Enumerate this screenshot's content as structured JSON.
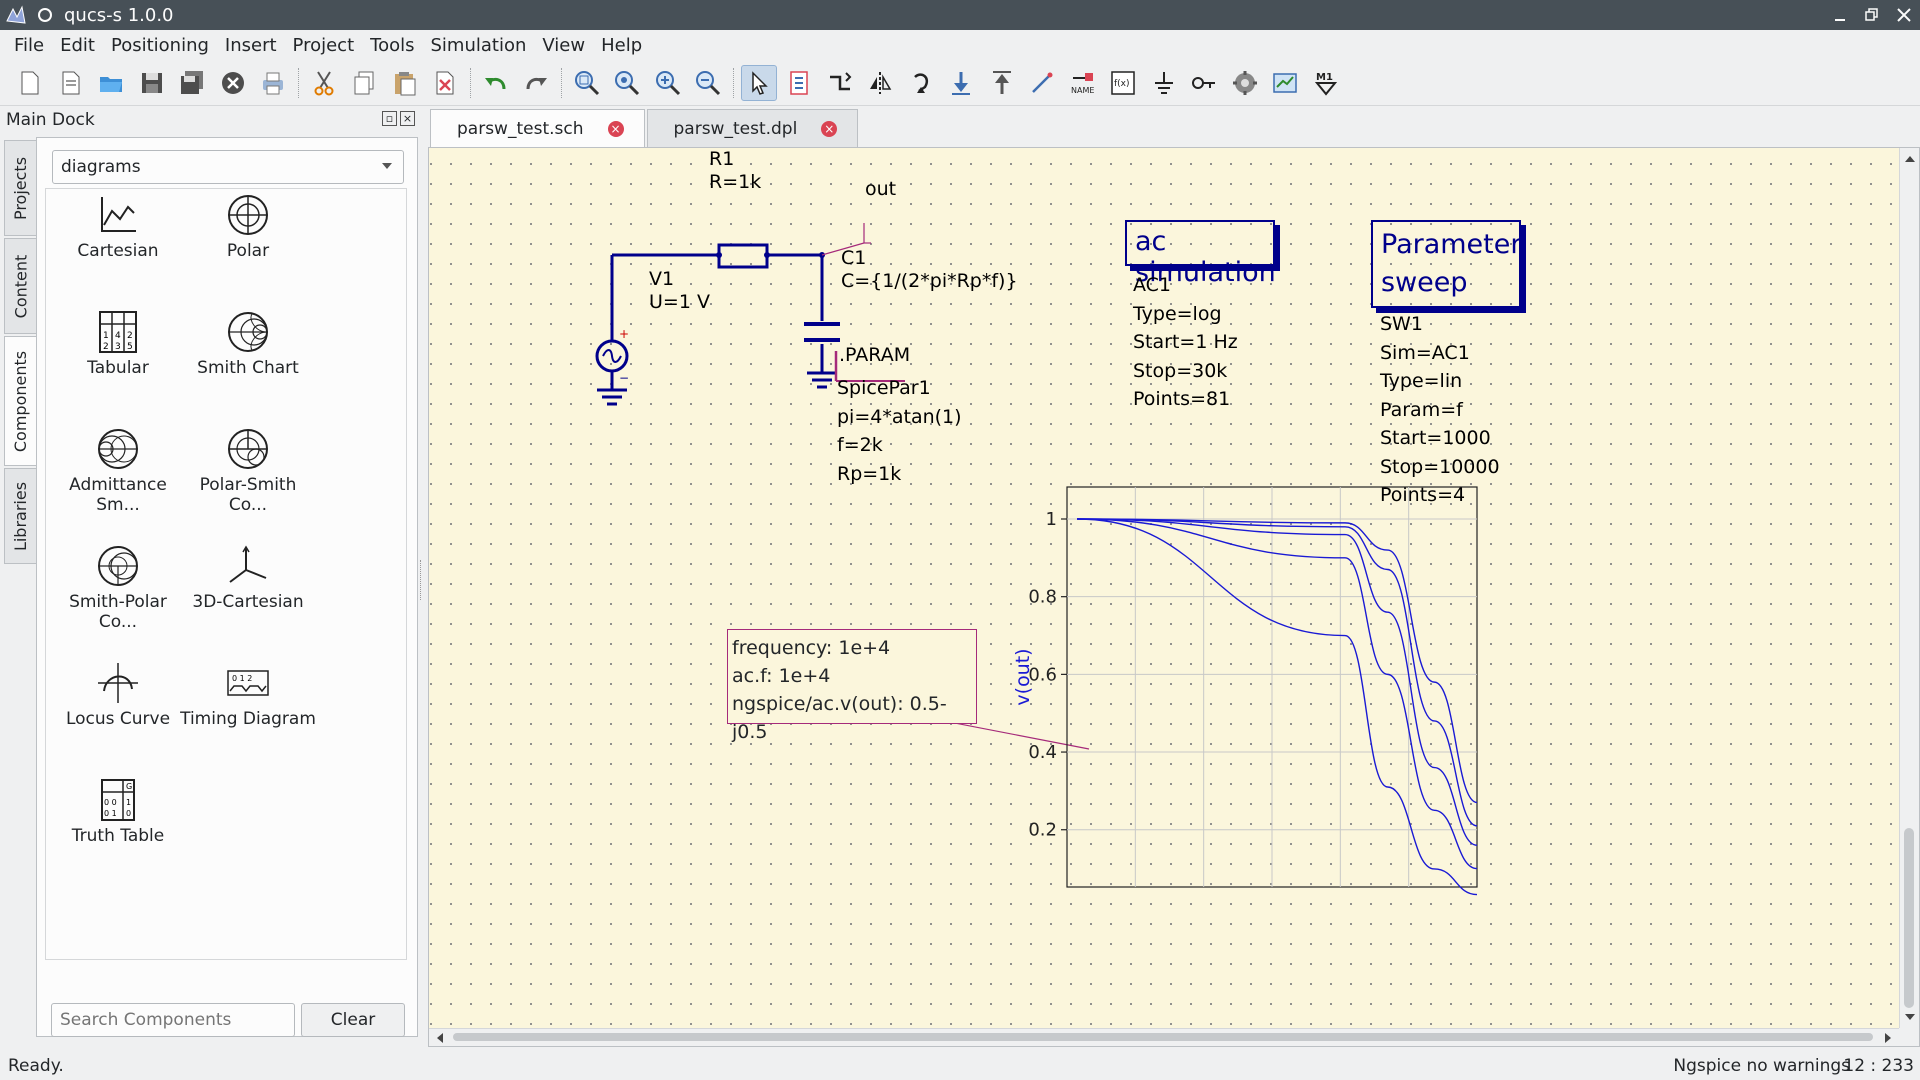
{
  "window": {
    "title": "qucs-s 1.0.0"
  },
  "menu": [
    "File",
    "Edit",
    "Positioning",
    "Insert",
    "Project",
    "Tools",
    "Simulation",
    "View",
    "Help"
  ],
  "toolbar": {
    "icons": [
      "new-file-icon",
      "new-text-icon",
      "open-folder-icon",
      "save-icon",
      "save-all-icon",
      "close-document-icon",
      "print-icon",
      "cut-icon",
      "copy-icon",
      "paste-icon",
      "delete-icon",
      "undo-icon",
      "redo-icon",
      "zoom-fit-icon",
      "zoom-selection-icon",
      "zoom-in-icon",
      "zoom-out-icon",
      "select-pointer-icon",
      "edit-properties-icon",
      "rotate-mirror-icon",
      "mirror-icon",
      "rotate-icon",
      "enter-subcircuit-icon",
      "exit-subcircuit-icon",
      "wire-icon",
      "wire-label-icon",
      "equation-icon",
      "ground-icon",
      "port-icon",
      "simulate-icon",
      "view-results-icon",
      "set-marker-icon"
    ]
  },
  "dock": {
    "title": "Main Dock",
    "tabs": [
      "Projects",
      "Content",
      "Components",
      "Libraries"
    ],
    "active_tab": "Components",
    "category": "diagrams",
    "components": [
      {
        "label": "Cartesian",
        "icon": "cartesian-diagram-icon"
      },
      {
        "label": "Polar",
        "icon": "polar-diagram-icon"
      },
      {
        "label": "Tabular",
        "icon": "tabular-diagram-icon"
      },
      {
        "label": "Smith Chart",
        "icon": "smith-chart-icon"
      },
      {
        "label": "Admittance Sm...",
        "icon": "admittance-smith-icon"
      },
      {
        "label": "Polar-Smith Co...",
        "icon": "polar-smith-icon"
      },
      {
        "label": "Smith-Polar Co...",
        "icon": "smith-polar-icon"
      },
      {
        "label": "3D-Cartesian",
        "icon": "3d-cartesian-icon"
      },
      {
        "label": "Locus Curve",
        "icon": "locus-curve-icon"
      },
      {
        "label": "Timing Diagram",
        "icon": "timing-diagram-icon"
      },
      {
        "label": "Truth Table",
        "icon": "truth-table-icon"
      }
    ],
    "search_placeholder": "Search Components",
    "clear_label": "Clear"
  },
  "tabs": [
    {
      "label": "parsw_test.sch",
      "active": true
    },
    {
      "label": "parsw_test.dpl",
      "active": false
    }
  ],
  "schematic": {
    "r1_name": "R1",
    "r1_value": "R=1k",
    "out_label": "out",
    "c1_name": "C1",
    "c1_value": "C={1/(2*pi*Rp*f)}",
    "v1_name": "V1",
    "v1_value": "U=1 V",
    "ac_title": "ac simulation",
    "ac_props": [
      "AC1",
      "Type=log",
      "Start=1 Hz",
      "Stop=30k",
      "Points=81"
    ],
    "sweep_title": [
      "Parameter",
      "sweep"
    ],
    "sweep_props": [
      "SW1",
      "Sim=AC1",
      "Type=lin",
      "Param=f",
      "Start=1000",
      "Stop=10000",
      "Points=4"
    ],
    "param_title": ".PARAM",
    "param_props": [
      "SpicePar1",
      "pi=4*atan(1)",
      "f=2k",
      "Rp=1k"
    ]
  },
  "marker": [
    "frequency: 1e+4",
    "ac.f: 1e+4",
    "ngspice/ac.v(out): 0.5-j0.5"
  ],
  "chart_data": {
    "type": "line",
    "ylabel": "v(out)",
    "xlim": [
      1,
      30000
    ],
    "ylim": [
      0.05,
      1.05
    ],
    "yticks": [
      "1",
      "0.8",
      "0.6",
      "0.4",
      "0.2"
    ],
    "xscale": "log",
    "grid": true,
    "series": [
      {
        "values": [
          [
            1,
            1
          ],
          [
            1000,
            0.7
          ],
          [
            3000,
            0.31
          ],
          [
            10000,
            0.099
          ],
          [
            30000,
            0.033
          ]
        ]
      },
      {
        "values": [
          [
            1,
            1
          ],
          [
            1000,
            0.9
          ],
          [
            3000,
            0.6
          ],
          [
            10000,
            0.25
          ],
          [
            30000,
            0.1
          ]
        ]
      },
      {
        "values": [
          [
            1,
            1
          ],
          [
            1000,
            0.96
          ],
          [
            3000,
            0.76
          ],
          [
            10000,
            0.36
          ],
          [
            30000,
            0.16
          ]
        ]
      },
      {
        "values": [
          [
            1,
            1
          ],
          [
            1000,
            0.98
          ],
          [
            3000,
            0.87
          ],
          [
            10000,
            0.48
          ],
          [
            30000,
            0.21
          ]
        ]
      },
      {
        "values": [
          [
            1,
            1
          ],
          [
            1000,
            0.99
          ],
          [
            3000,
            0.92
          ],
          [
            10000,
            0.58
          ],
          [
            30000,
            0.27
          ]
        ]
      }
    ],
    "series_color": "#1a1ad4"
  },
  "status": {
    "text": "Ready.",
    "sim": "Ngspice  no warnings",
    "coords": "12 : 233"
  }
}
